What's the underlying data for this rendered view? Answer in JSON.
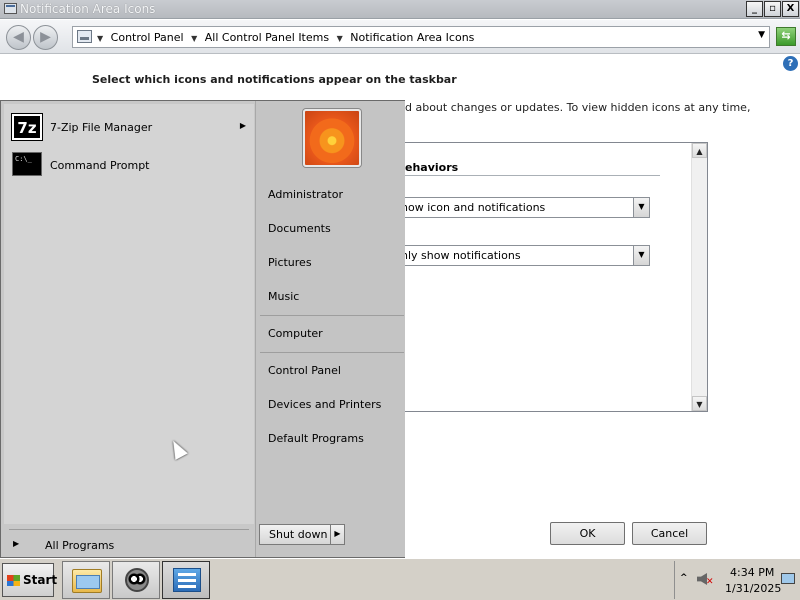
{
  "window": {
    "title": "Notification Area Icons",
    "controls": {
      "minimize": "_",
      "maximize": "▫",
      "close": "X"
    }
  },
  "address_bar": {
    "crumbs": [
      "Control Panel",
      "All Control Panel Items",
      "Notification Area Icons"
    ],
    "icon": "control-panel-icon"
  },
  "content": {
    "heading": "Select which icons and notifications appear on the taskbar",
    "description_visible": "d about changes or updates. To view hidden icons at any time,",
    "column_header": "ehaviors",
    "rows": [
      {
        "behavior": "how icon and notifications"
      },
      {
        "behavior": "nly show notifications"
      }
    ],
    "ok_label": "OK",
    "cancel_label": "Cancel"
  },
  "start_menu": {
    "programs": [
      {
        "label": "7-Zip File Manager",
        "icon": "7zip-icon",
        "has_submenu": true
      },
      {
        "label": "Command Prompt",
        "icon": "command-prompt-icon",
        "has_submenu": false
      }
    ],
    "all_programs_label": "All Programs",
    "right_links": [
      "Administrator",
      "Documents",
      "Pictures",
      "Music",
      "Computer",
      "Control Panel",
      "Devices and Printers",
      "Default Programs"
    ],
    "shutdown_label": "Shut down"
  },
  "taskbar": {
    "start_label": "Start",
    "pinned": [
      "windows-explorer-icon",
      "raccoon-app-icon",
      "control-panel-icon"
    ],
    "tray": {
      "time": "4:34 PM",
      "date": "1/31/2025",
      "icons": [
        "show-hidden-icons-chevron",
        "speaker-muted-icon",
        "network-icon"
      ]
    }
  }
}
